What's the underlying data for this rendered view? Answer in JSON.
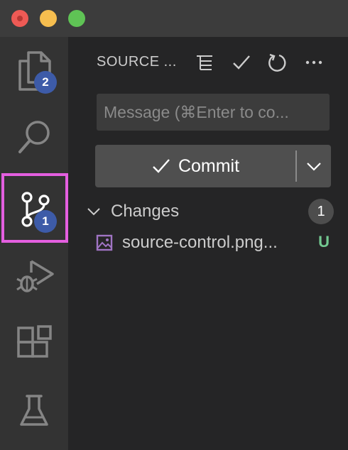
{
  "window": {
    "traffic_lights": {
      "close": "#ee5a55",
      "minimize": "#f6be4f",
      "zoom": "#5fc355"
    }
  },
  "activity_bar": {
    "items": [
      {
        "name": "explorer",
        "icon": "files-icon",
        "badge": "2"
      },
      {
        "name": "search",
        "icon": "search-icon"
      },
      {
        "name": "source-control",
        "icon": "source-control-icon",
        "badge": "1",
        "active": true
      },
      {
        "name": "run-and-debug",
        "icon": "run-debug-icon"
      },
      {
        "name": "extensions",
        "icon": "extensions-icon"
      },
      {
        "name": "testing",
        "icon": "beaker-icon"
      }
    ],
    "highlight_color": "#e45fe0",
    "badge_color": "#3d5ba8"
  },
  "sidebar": {
    "title": "SOURCE ...",
    "toolbar": [
      "view-as-tree-icon",
      "commit-check-icon",
      "refresh-icon",
      "more-actions-icon"
    ],
    "message_placeholder": "Message (⌘Enter to co...",
    "commit_label": "Commit",
    "changes": {
      "label": "Changes",
      "count": "1",
      "files": [
        {
          "name": "source-control.png...",
          "status": "U",
          "status_color": "#73c991",
          "icon": "image-file-icon"
        }
      ]
    }
  }
}
